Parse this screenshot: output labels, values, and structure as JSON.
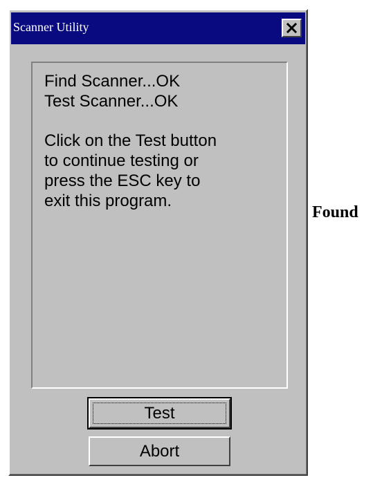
{
  "window": {
    "title": "Scanner Utility",
    "close_symbol": "×"
  },
  "message": {
    "line_1": "Find Scanner...OK",
    "line_2": "Test Scanner...OK",
    "instruction_lines": [
      "Click on the Test button",
      "to continue testing or",
      "press the ESC key to",
      "exit this program."
    ]
  },
  "buttons": {
    "test_label": "Test",
    "abort_label": "Abort"
  },
  "page": {
    "side_caption": "Found"
  },
  "colors": {
    "title_bar": "#0a0a80",
    "window_face": "#c0c0c0",
    "title_text": "#ffffff"
  },
  "icons": {
    "close": "close-icon"
  }
}
